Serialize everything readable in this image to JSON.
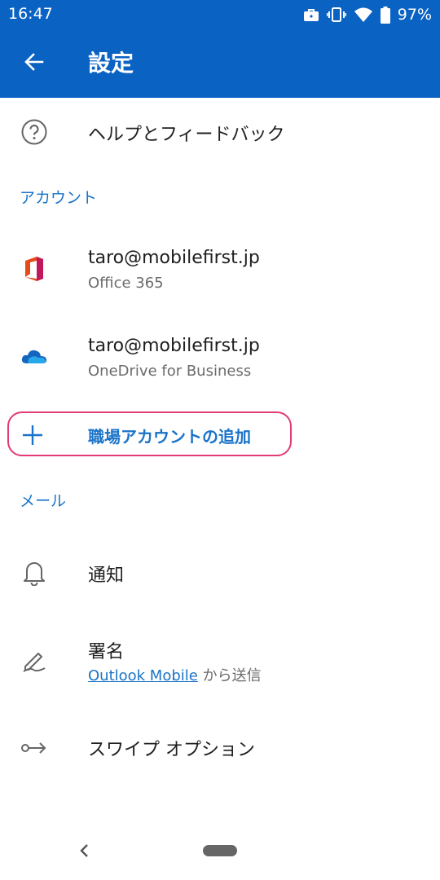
{
  "status_bar": {
    "time": "16:47",
    "battery": "97%",
    "icons": [
      "briefcase-icon",
      "vibrate-icon",
      "wifi-icon",
      "battery-icon"
    ]
  },
  "app_bar": {
    "title": "設定",
    "back_icon": "arrow-left-icon"
  },
  "help": {
    "label": "ヘルプとフィードバック",
    "icon": "question-circle-icon"
  },
  "accounts_section": {
    "header": "アカウント",
    "items": [
      {
        "email": "taro@mobilefirst.jp",
        "service": "Office 365",
        "icon": "office-365-icon"
      },
      {
        "email": "taro@mobilefirst.jp",
        "service": "OneDrive for Business",
        "icon": "onedrive-icon"
      }
    ],
    "add_label": "職場アカウントの追加",
    "add_icon": "plus-icon"
  },
  "mail_section": {
    "header": "メール",
    "notifications": {
      "label": "通知",
      "icon": "bell-icon"
    },
    "signature": {
      "label": "署名",
      "link_text": "Outlook Mobile",
      "suffix": " から送信",
      "icon": "signature-pen-icon"
    },
    "swipe": {
      "label": "スワイプ オプション",
      "icon": "swipe-arrow-icon"
    }
  },
  "colors": {
    "accent": "#0a62c3",
    "link": "#1a73c8",
    "highlight": "#e33a78"
  }
}
